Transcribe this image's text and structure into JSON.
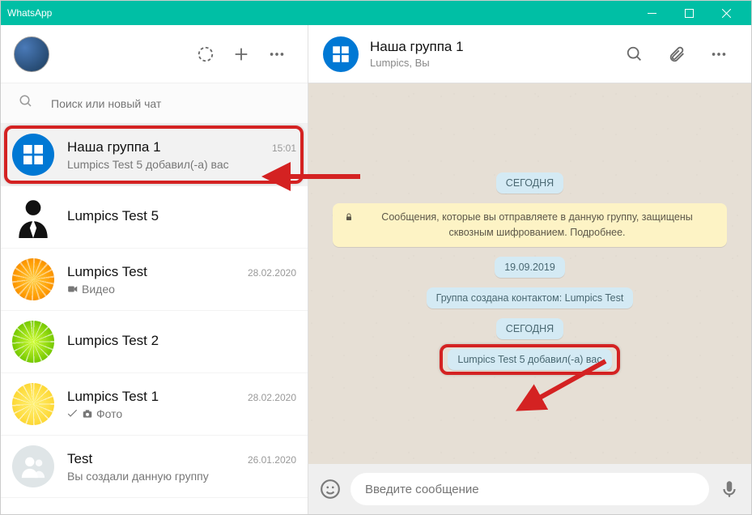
{
  "app_title": "WhatsApp",
  "search": {
    "placeholder": "Поиск или новый чат"
  },
  "chats": [
    {
      "name": "Наша группа 1",
      "msg": "Lumpics Test 5 добавил(-а) вас",
      "time": "15:01"
    },
    {
      "name": "Lumpics Test 5",
      "msg": "",
      "time": ""
    },
    {
      "name": "Lumpics Test",
      "msg": "Видео",
      "time": "28.02.2020"
    },
    {
      "name": "Lumpics Test 2",
      "msg": "",
      "time": ""
    },
    {
      "name": "Lumpics Test 1",
      "msg": "Фото",
      "time": "28.02.2020"
    },
    {
      "name": "Test",
      "msg": "Вы создали данную группу",
      "time": "26.01.2020"
    }
  ],
  "chat_header": {
    "title": "Наша группа 1",
    "subtitle": "Lumpics, Вы"
  },
  "messages": {
    "today1": "СЕГОДНЯ",
    "encryption": "Сообщения, которые вы отправляете в данную группу, защищены сквозным шифрованием. Подробнее.",
    "date1": "19.09.2019",
    "created": "Группа создана контактом: Lumpics Test",
    "today2": "СЕГОДНЯ",
    "added": "Lumpics Test 5 добавил(-а) вас"
  },
  "compose": {
    "placeholder": "Введите сообщение"
  }
}
